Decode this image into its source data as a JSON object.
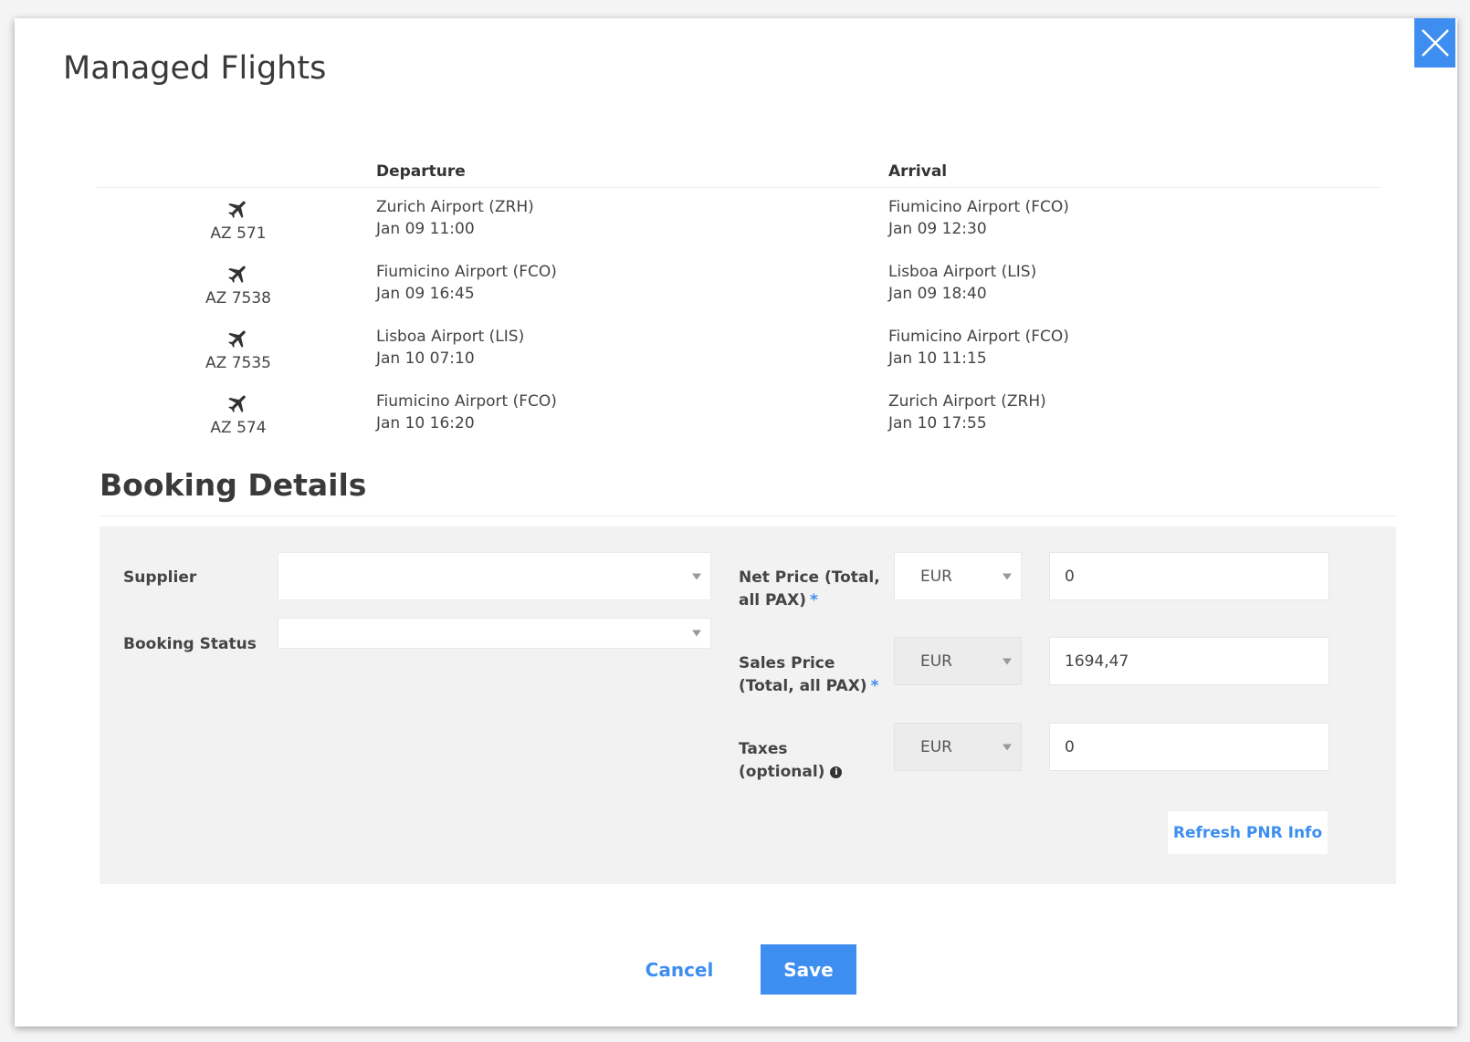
{
  "modal": {
    "title": "Managed Flights"
  },
  "flights": {
    "headers": {
      "departure": "Departure",
      "arrival": "Arrival"
    },
    "rows": [
      {
        "code": "AZ 571",
        "dep_airport": "Zurich Airport (ZRH)",
        "dep_time": "Jan 09 11:00",
        "arr_airport": "Fiumicino Airport (FCO)",
        "arr_time": "Jan 09 12:30"
      },
      {
        "code": "AZ 7538",
        "dep_airport": "Fiumicino Airport (FCO)",
        "dep_time": "Jan 09 16:45",
        "arr_airport": "Lisboa Airport (LIS)",
        "arr_time": "Jan 09 18:40"
      },
      {
        "code": "AZ 7535",
        "dep_airport": "Lisboa Airport (LIS)",
        "dep_time": "Jan 10 07:10",
        "arr_airport": "Fiumicino Airport (FCO)",
        "arr_time": "Jan 10 11:15"
      },
      {
        "code": "AZ 574",
        "dep_airport": "Fiumicino Airport (FCO)",
        "dep_time": "Jan 10 16:20",
        "arr_airport": "Zurich Airport (ZRH)",
        "arr_time": "Jan 10 17:55"
      }
    ]
  },
  "booking": {
    "title": "Booking Details",
    "supplier_label": "Supplier",
    "supplier_value": "",
    "status_label": "Booking Status",
    "status_value": "",
    "net_price_label_1": "Net Price (Total,",
    "net_price_label_2": "all PAX)",
    "net_price_currency": "EUR",
    "net_price_value": "0",
    "sales_price_label_1": "Sales Price",
    "sales_price_label_2": "(Total, all PAX)",
    "sales_price_currency": "EUR",
    "sales_price_value": "1694,47",
    "taxes_label_1": "Taxes",
    "taxes_label_2": "(optional)",
    "taxes_currency": "EUR",
    "taxes_value": "0",
    "required_marker": "*",
    "info_glyph": "i",
    "refresh_label": "Refresh PNR Info"
  },
  "footer": {
    "cancel_label": "Cancel",
    "save_label": "Save"
  },
  "colors": {
    "accent": "#3d8ef0",
    "panel_bg": "#f2f2f2"
  },
  "icons": {
    "close": "close-icon",
    "flight": "plane-icon",
    "info": "info-icon",
    "dropdown": "chevron-down-icon"
  }
}
